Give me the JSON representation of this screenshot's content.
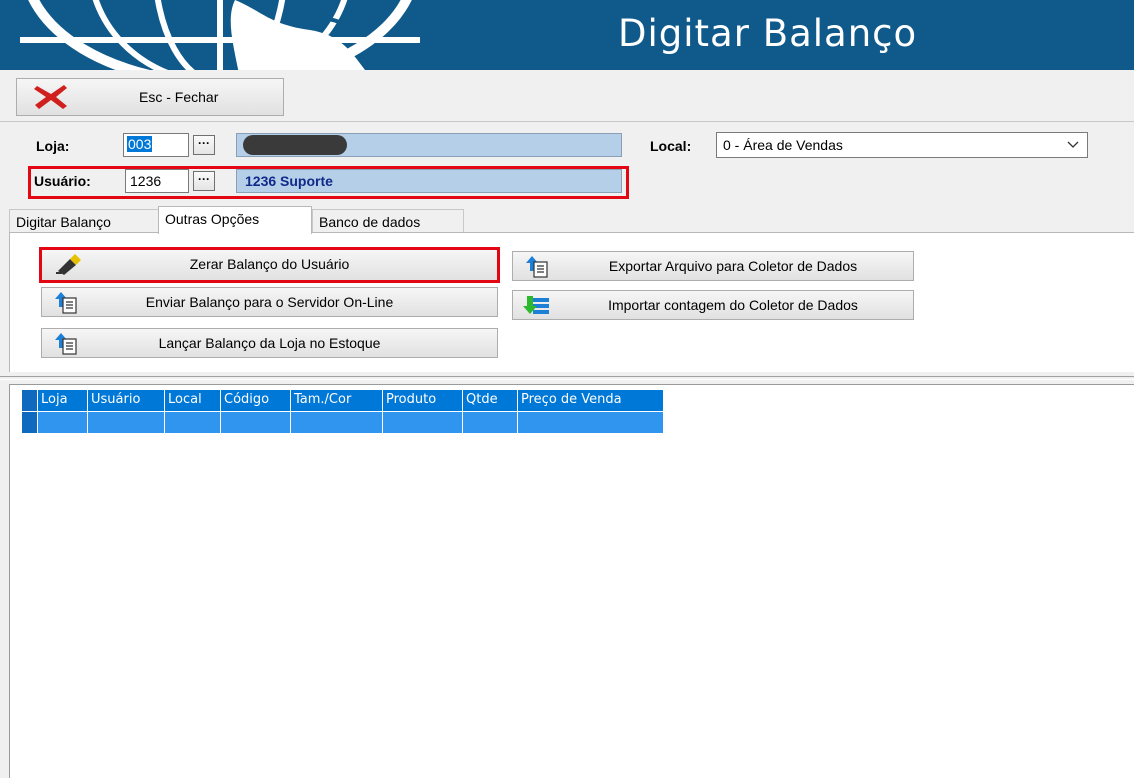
{
  "header": {
    "title": "Digitar Balanço"
  },
  "toolbar": {
    "close_label": "Esc - Fechar"
  },
  "form": {
    "loja_label": "Loja:",
    "loja_code": "003",
    "loja_name": "",
    "local_label": "Local:",
    "local_value": "0 - Área de Vendas",
    "usuario_label": "Usuário:",
    "usuario_code": "1236",
    "usuario_name": "1236 Suporte"
  },
  "tabs": [
    {
      "label": "Digitar Balanço"
    },
    {
      "label": "Outras Opções"
    },
    {
      "label": "Banco de dados"
    }
  ],
  "actions": {
    "zerar": "Zerar Balanço do Usuário",
    "enviar": "Enviar Balanço para o Servidor On-Line",
    "lancar": "Lançar Balanço da Loja no Estoque",
    "exportar": "Exportar Arquivo para Coletor de Dados",
    "importar": "Importar contagem do Coletor de Dados"
  },
  "grid": {
    "columns": [
      "Loja",
      "Usuário",
      "Local",
      "Código",
      "Tam./Cor",
      "Produto",
      "Qtde",
      "Preço de Venda"
    ]
  },
  "colors": {
    "header_bg": "#0f5a8a",
    "highlight": "#e30613",
    "grid_header": "#0078d7",
    "grid_row": "#2f95ee"
  },
  "icons": [
    "globe-icon",
    "close-x-icon",
    "eraser-icon",
    "upload-list-icon",
    "download-list-icon",
    "dropdown-chevron-icon"
  ]
}
